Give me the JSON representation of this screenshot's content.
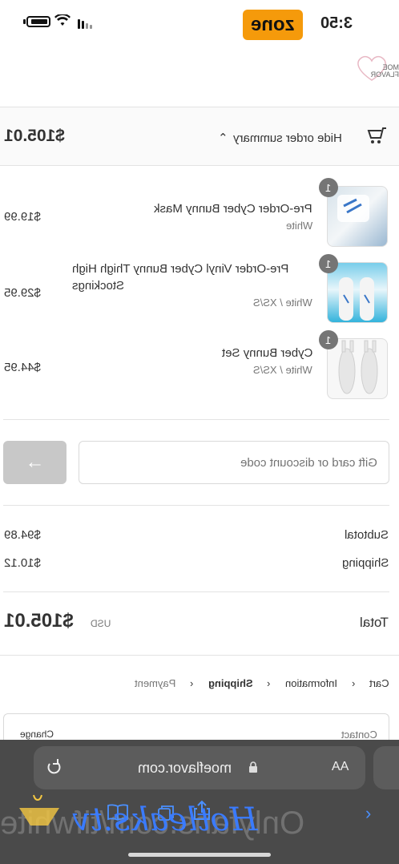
{
  "status_bar": {
    "clock": "3:50",
    "carrier_badge": "zone"
  },
  "store": {
    "logo_text": "MOE FLAVOR"
  },
  "summary": {
    "toggle_label": "Hide order summary",
    "total": "$105.01"
  },
  "items": [
    {
      "qty": "1",
      "name": "Pre-Order Cyber Bunny Mask",
      "variant": "White",
      "price": "$19.99"
    },
    {
      "qty": "1",
      "name": "Pre-Order Vinyl Cyber Bunny Thigh High Stockings",
      "variant": "White / XS/S",
      "price": "$29.95"
    },
    {
      "qty": "1",
      "name": "Cyber Bunny Set",
      "variant": "White / XS/S",
      "price": "$44.95"
    }
  ],
  "discount": {
    "placeholder": "Gift card or discount code"
  },
  "totals": {
    "subtotal_label": "Subtotal",
    "subtotal": "$94.89",
    "shipping_label": "Shipping",
    "shipping": "$10.12",
    "total_label": "Total",
    "currency": "USD",
    "total": "$105.01"
  },
  "breadcrumb": {
    "cart": "Cart",
    "information": "Information",
    "shipping": "Shipping",
    "payment": "Payment"
  },
  "contact": {
    "label": "Contact",
    "change": "Change"
  },
  "browser": {
    "url": "moeflavor.com",
    "text_size": "AA"
  },
  "watermarks": {
    "script": "Hotleaks.tv",
    "overlay": "Onlyfans.com/tifwhite"
  }
}
